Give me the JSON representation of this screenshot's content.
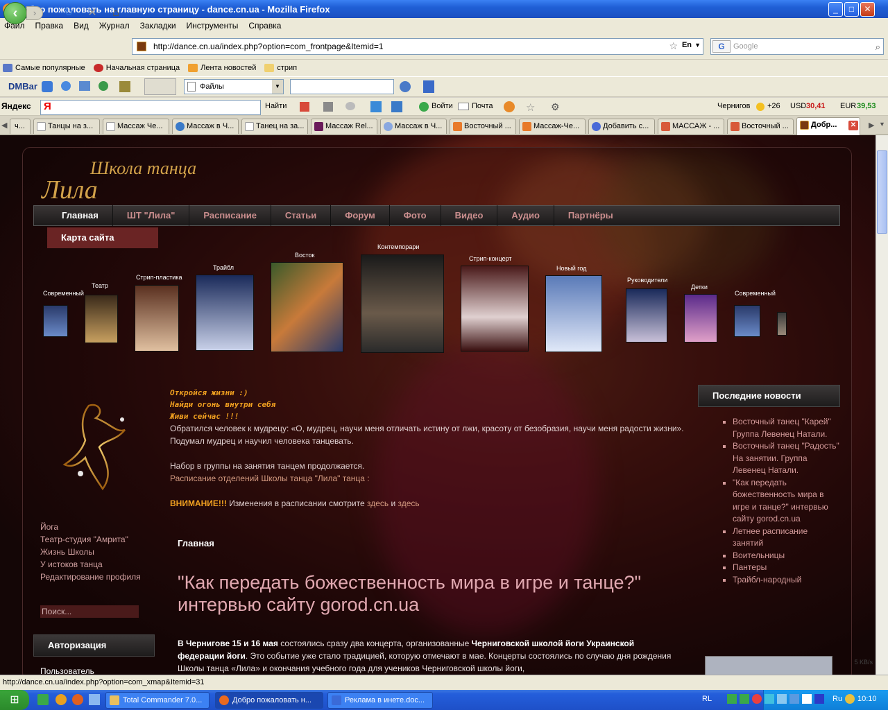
{
  "window": {
    "title": "Добро пожаловать на главную страницу - dance.cn.ua - Mozilla Firefox"
  },
  "menu": [
    "Файл",
    "Правка",
    "Вид",
    "Журнал",
    "Закладки",
    "Инструменты",
    "Справка"
  ],
  "nav": {
    "url": "http://dance.cn.ua/index.php?option=com_frontpage&Itemid=1",
    "lang": "En",
    "search_placeholder": "Google"
  },
  "bookmarks": [
    "Самые популярные",
    "Начальная страница",
    "Лента новостей",
    "стрип"
  ],
  "dmbar": {
    "label": "DMBar",
    "files": "Файлы"
  },
  "yandex": {
    "label": "Яндекс",
    "find": "Найти",
    "login": "Войти",
    "mail": "Почта",
    "city": "Чернигов",
    "temp": "+26",
    "usd_label": "USD",
    "usd": "30,41",
    "eur_label": "EUR",
    "eur": "39,53"
  },
  "tabs": [
    {
      "label": "ч..."
    },
    {
      "label": "Танцы на з..."
    },
    {
      "label": "Массаж Че..."
    },
    {
      "label": "Массаж в Ч..."
    },
    {
      "label": "Танец на за..."
    },
    {
      "label": "Массаж Rel..."
    },
    {
      "label": "Массаж в Ч..."
    },
    {
      "label": "Восточный ..."
    },
    {
      "label": "Массаж-Че..."
    },
    {
      "label": "Добавить с..."
    },
    {
      "label": "МАССАЖ - ..."
    },
    {
      "label": "Восточный ..."
    },
    {
      "label": "Добр..."
    }
  ],
  "site": {
    "logo_top": "Школа танца",
    "logo_bottom": "Лила",
    "nav": [
      "Главная",
      "ШТ \"Лила\"",
      "Расписание",
      "Статьи",
      "Форум",
      "Фото",
      "Видео",
      "Аудио",
      "Партнёры"
    ],
    "sitemap": "Карта сайта",
    "gallery": [
      "Современный",
      "Театр",
      "Стрип-пластика",
      "Трайбл",
      "Восток",
      "Контемпорари",
      "Стрип-концерт",
      "Новый год",
      "Руководители",
      "Детки",
      "Современный"
    ],
    "left_menu": [
      "Йога",
      "Театр-студия \"Амрита\"",
      "Жизнь Школы",
      "У истоков танца",
      "Редактирование профиля"
    ],
    "search": "Поиск...",
    "auth_title": "Авторизация",
    "auth_user": "Пользователь",
    "motto": [
      "Откройся жизни :)",
      "Найди огонь внутри себя",
      "Живи сейчас !!!"
    ],
    "intro": "Обратился человек к мудрецу: «О, мудрец, научи меня отличать истину от лжи, красоту от безобразия, научи меня радости жизни». Подумал мудрец и научил человека танцевать.",
    "recruit": "Набор в группы на занятия танцем продолжается.",
    "schedule_link": "Расписание отделений Школы танца \"Лила\"  танца :",
    "warn": "ВНИМАНИЕ!!!",
    "warn_text": " Изменения в расписании смотрите ",
    "here1": "здесь",
    "and": " и ",
    "here2": "здесь",
    "crumb": "Главная",
    "headline": "\"Как передать божественность мира в игре и танце?\" интервью сайту gorod.cn.ua",
    "article_b1": "В Чернигове 15 и 16 мая",
    "article_t1": " состоялись сразу два концерта, организованные ",
    "article_b2": "Черниговской школой йоги Украинской федерации йоги",
    "article_t2": ". Это событие уже стало традицией, которую отмечают в мае. Концерты состоялись по случаю дня рождения Школы танца «Лила» и окончания учебного года для учеников Черниговской школы йоги,",
    "news_title": "Последние новости",
    "news": [
      "Восточный танец \"Карей\" Группа Левенец Натали.",
      "Восточный танец \"Радость\" На занятии. Группа Левенец Натали.",
      "\"Как передать божественность мира в игре и танце?\" интервью сайту gorod.cn.ua",
      "Летнее расписание занятий",
      "Воительницы",
      "Пантеры",
      "Трайбл-народный"
    ]
  },
  "download_speed": "5 KB/s",
  "status": "http://dance.cn.ua/index.php?option=com_xmap&Itemid=31",
  "taskbar": {
    "items": [
      "Total Commander 7.0...",
      "Добро пожаловать н...",
      "Реклама в инете.doc..."
    ],
    "lang": "RL",
    "kbd": "Ru",
    "clock": "10:10"
  }
}
